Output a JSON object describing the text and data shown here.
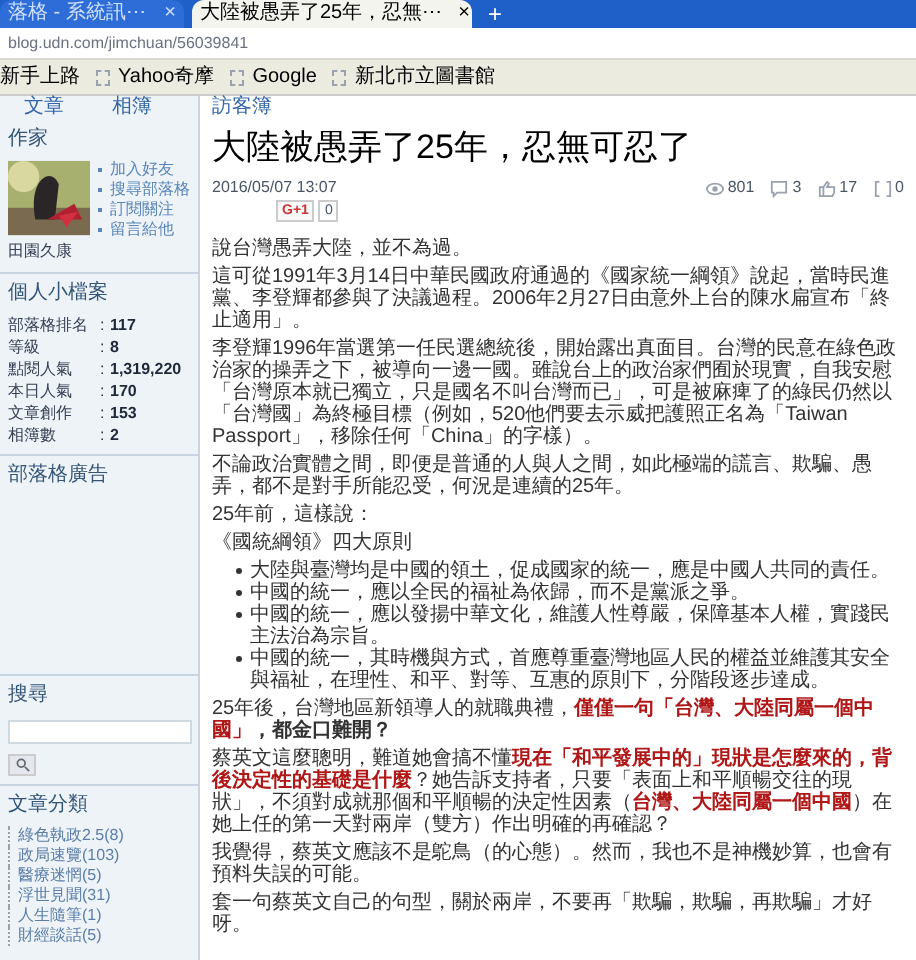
{
  "browser": {
    "tabs": [
      {
        "label": "落格 - 系統訊⋯",
        "selected": false,
        "close": "×"
      },
      {
        "label": "大陸被愚弄了25年，忍無⋯",
        "selected": true,
        "close": "×"
      }
    ],
    "new_tab": "+",
    "address": "blog.udn.com/jimchuan/56039841",
    "bookmarks": [
      {
        "label": "新手上路"
      },
      {
        "label": "Yahoo奇摩"
      },
      {
        "label": "Google"
      },
      {
        "label": "新北市立圖書館"
      }
    ]
  },
  "nav": [
    {
      "label": "文章"
    },
    {
      "label": "相簿"
    },
    {
      "label": "訪客簿"
    }
  ],
  "sidebar": {
    "author": {
      "heading": "作家",
      "name": "田園久康",
      "links": [
        "加入好友",
        "搜尋部落格",
        "訂閱關注",
        "留言給他"
      ]
    },
    "profile": {
      "heading": "個人小檔案",
      "stats": [
        {
          "label": "部落格排名",
          "sep": ":",
          "value": "117"
        },
        {
          "label": "等級",
          "sep": ":",
          "value": "8"
        },
        {
          "label": "點閱人氣",
          "sep": ":",
          "value": "1,319,220"
        },
        {
          "label": "本日人氣",
          "sep": ":",
          "value": "170"
        },
        {
          "label": "文章創作",
          "sep": ":",
          "value": "153"
        },
        {
          "label": "相簿數",
          "sep": ":",
          "value": "2"
        }
      ]
    },
    "ads": {
      "heading": "部落格廣告"
    },
    "search": {
      "heading": "搜尋"
    },
    "categories": {
      "heading": "文章分類",
      "items": [
        "綠色執政2.5(8)",
        "政局速覽(103)",
        "醫療迷惘(5)",
        "浮世見聞(31)",
        "人生隨筆(1)",
        "財經談話(5)"
      ]
    }
  },
  "article": {
    "title": "大陸被愚弄了25年，忍無可忍了",
    "date": "2016/05/07 13:07",
    "stats": [
      {
        "kind": "views",
        "value": "801"
      },
      {
        "kind": "comments",
        "value": "3"
      },
      {
        "kind": "likes",
        "value": "17"
      },
      {
        "kind": "shares",
        "value": "0"
      }
    ],
    "gplus": {
      "label": "G+1",
      "count": "0"
    },
    "blocks": [
      {
        "kind": "text",
        "segments": [
          {
            "kind": "plain",
            "text": "說台灣愚弄大陸，並不為過。"
          }
        ]
      },
      {
        "kind": "text",
        "segments": [
          {
            "kind": "plain",
            "text": "這可從1991年3月14日中華民國政府通過的《國家統一綱領》說起，當時民進黨、李登輝都參與了決議過程。2006年2月27日由意外上台的陳水扁宣布「終止適用」。"
          }
        ]
      },
      {
        "kind": "text",
        "segments": [
          {
            "kind": "plain",
            "text": "李登輝1996年當選第一任民選總統後，開始露出真面目。台灣的民意在綠色政治家的操弄之下，被導向一邊一國。雖說台上的政治家們囿於現實，自我安慰「台灣原本就已獨立，只是國名不叫台灣而已」，可是被麻痺了的綠民仍然以「台灣國」為終極目標（例如，520他們要去示威把護照正名為「Taiwan Passport」，移除任何「China」的字樣）。"
          }
        ]
      },
      {
        "kind": "text",
        "segments": [
          {
            "kind": "plain",
            "text": "不論政治實體之間，即便是普通的人與人之間，如此極端的謊言、欺騙、愚弄，都不是對手所能忍受，何況是連續的25年。"
          }
        ]
      },
      {
        "kind": "text",
        "segments": [
          {
            "kind": "plain",
            "text": "25年前，這樣說："
          }
        ]
      },
      {
        "kind": "text",
        "segments": [
          {
            "kind": "plain",
            "text": "《國統綱領》四大原則"
          }
        ]
      },
      {
        "kind": "list",
        "items": [
          "大陸與臺灣均是中國的領土，促成國家的統一，應是中國人共同的責任。",
          "中國的統一，應以全民的福祉為依歸，而不是黨派之爭。",
          "中國的統一，應以發揚中華文化，維護人性尊嚴，保障基本人權，實踐民主法治為宗旨。",
          "中國的統一，其時機與方式，首應尊重臺灣地區人民的權益並維護其安全與福祉，在理性、和平、對等、互惠的原則下，分階段逐步達成。"
        ]
      },
      {
        "kind": "text",
        "segments": [
          {
            "kind": "plain",
            "text": "25年後，台灣地區新領導人的就職典禮，"
          },
          {
            "kind": "red",
            "text": "僅僅一句「台灣、大陸同屬一個中國」"
          },
          {
            "kind": "bold",
            "text": "，都金口難開？"
          }
        ]
      },
      {
        "kind": "text",
        "segments": [
          {
            "kind": "plain",
            "text": "蔡英文這麼聰明，難道她會搞不懂"
          },
          {
            "kind": "red",
            "text": "現在「和平發展中的」現狀是怎麼來的，背後決定性的基礎是什麼"
          },
          {
            "kind": "plain",
            "text": "？她告訴支持者，只要「表面上和平順暢交往的現狀」，不須對成就那個和平順暢的決定性因素（"
          },
          {
            "kind": "red",
            "text": "台灣、大陸同屬一個中國"
          },
          {
            "kind": "plain",
            "text": "）在她上任的第一天對兩岸（雙方）作出明確的再確認？"
          }
        ]
      },
      {
        "kind": "text",
        "segments": [
          {
            "kind": "plain",
            "text": "我覺得，蔡英文應該不是鴕鳥（的心態）。然而，我也不是神機妙算，也會有預料失誤的可能。"
          }
        ]
      },
      {
        "kind": "text",
        "segments": [
          {
            "kind": "plain",
            "text": "套一句蔡英文自己的句型，關於兩岸，不要再「欺騙，欺騙，再欺騙」才好呀。"
          }
        ]
      }
    ]
  }
}
